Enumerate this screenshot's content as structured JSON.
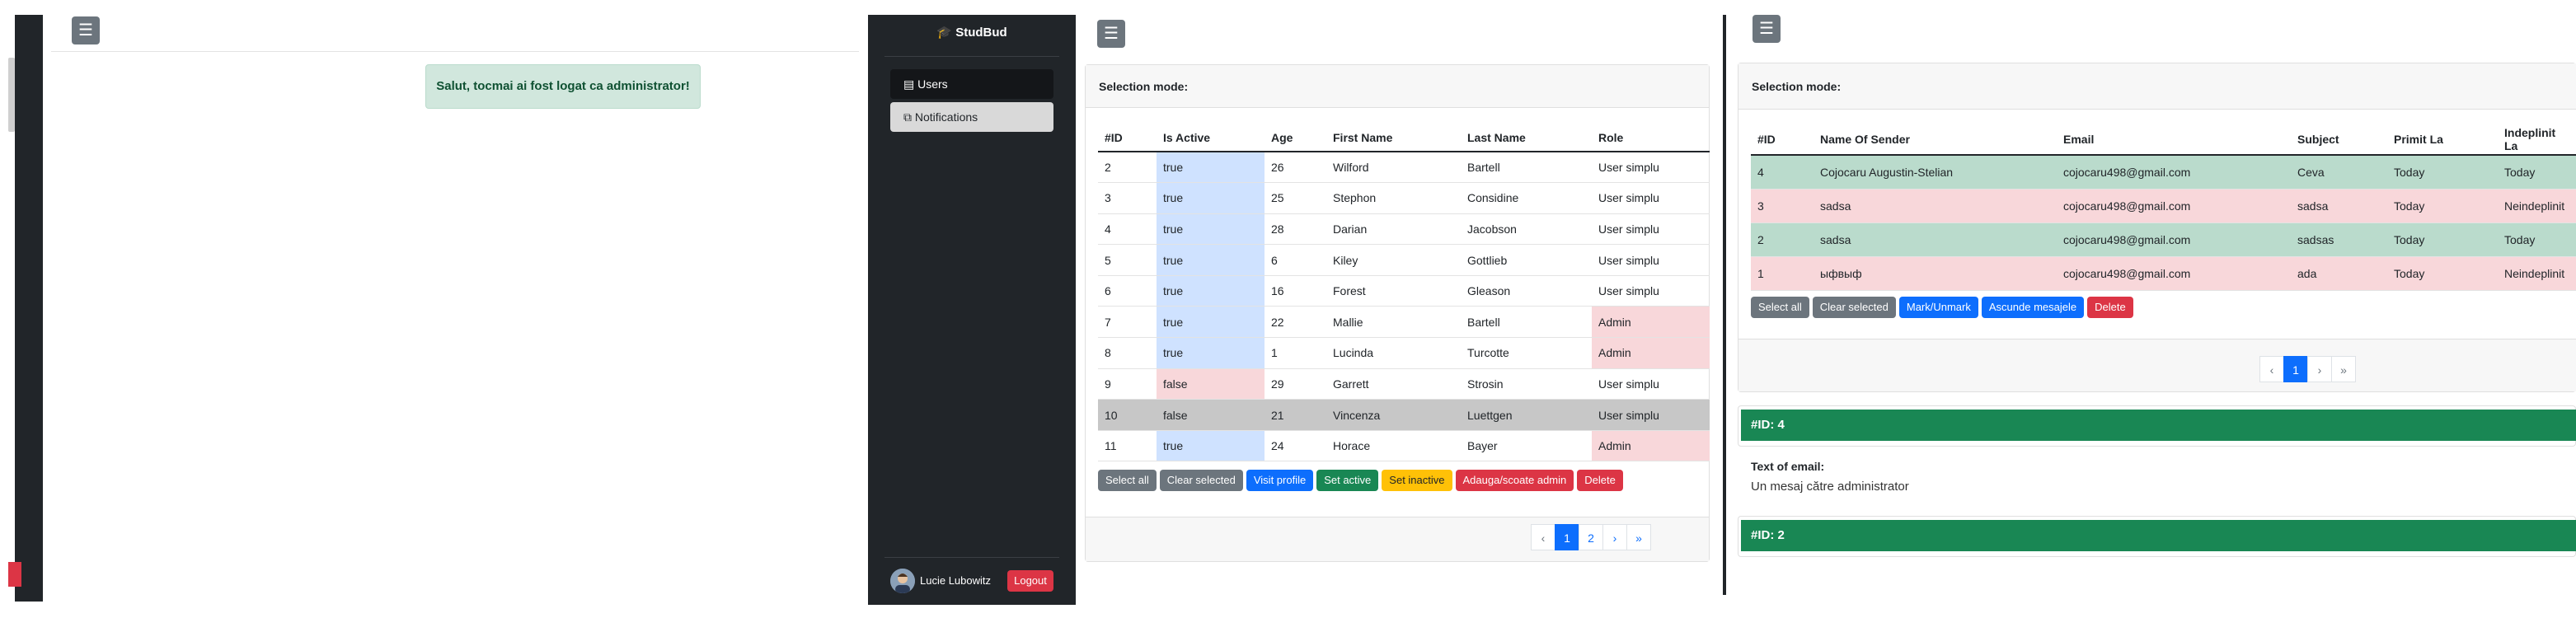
{
  "panel1": {
    "menu_icon": "menu-icon",
    "alert": "Salut, tocmai ai fost logat ca administrator!"
  },
  "sidebar": {
    "brand_icon": "graduation-cap-icon",
    "brand": "StudBud",
    "items": [
      {
        "label": "Users",
        "icon": "table-icon"
      },
      {
        "label": "Notifications",
        "icon": "external-link-icon"
      }
    ],
    "user_name": "Lucie Lubowitz",
    "logout": "Logout"
  },
  "users": {
    "selection_mode": "Selection mode:",
    "columns": [
      "#ID",
      "Is Active",
      "Age",
      "First Name",
      "Last Name",
      "Role"
    ],
    "rows": [
      {
        "id": "2",
        "active": "true",
        "age": "26",
        "first": "Wilford",
        "last": "Bartell",
        "role": "User simplu"
      },
      {
        "id": "3",
        "active": "true",
        "age": "25",
        "first": "Stephon",
        "last": "Considine",
        "role": "User simplu"
      },
      {
        "id": "4",
        "active": "true",
        "age": "28",
        "first": "Darian",
        "last": "Jacobson",
        "role": "User simplu"
      },
      {
        "id": "5",
        "active": "true",
        "age": "6",
        "first": "Kiley",
        "last": "Gottlieb",
        "role": "User simplu"
      },
      {
        "id": "6",
        "active": "true",
        "age": "16",
        "first": "Forest",
        "last": "Gleason",
        "role": "User simplu"
      },
      {
        "id": "7",
        "active": "true",
        "age": "22",
        "first": "Mallie",
        "last": "Bartell",
        "role": "Admin"
      },
      {
        "id": "8",
        "active": "true",
        "age": "1",
        "first": "Lucinda",
        "last": "Turcotte",
        "role": "Admin"
      },
      {
        "id": "9",
        "active": "false",
        "age": "29",
        "first": "Garrett",
        "last": "Strosin",
        "role": "User simplu"
      },
      {
        "id": "10",
        "active": "false",
        "age": "21",
        "first": "Vincenza",
        "last": "Luettgen",
        "role": "User simplu"
      },
      {
        "id": "11",
        "active": "true",
        "age": "24",
        "first": "Horace",
        "last": "Bayer",
        "role": "Admin"
      }
    ],
    "buttons": [
      "Select all",
      "Clear selected",
      "Visit profile",
      "Set active",
      "Set inactive",
      "Adauga/scoate admin",
      "Delete"
    ],
    "pagination": [
      "‹",
      "1",
      "2",
      "›",
      "»"
    ],
    "current_page": "1"
  },
  "messages": {
    "selection_mode": "Selection mode:",
    "columns": [
      "#ID",
      "Name Of Sender",
      "Email",
      "Subject",
      "Primit La",
      "Indeplinit La"
    ],
    "rows": [
      {
        "id": "4",
        "sender": "Cojocaru Augustin-Stelian",
        "email": "cojocaru498@gmail.com",
        "subject": "Ceva",
        "received": "Today",
        "done": "Today"
      },
      {
        "id": "3",
        "sender": "sadsa",
        "email": "cojocaru498@gmail.com",
        "subject": "sadsa",
        "received": "Today",
        "done": "Neindeplinit"
      },
      {
        "id": "2",
        "sender": "sadsa",
        "email": "cojocaru498@gmail.com",
        "subject": "sadsas",
        "received": "Today",
        "done": "Today"
      },
      {
        "id": "1",
        "sender": "ыфвыф",
        "email": "cojocaru498@gmail.com",
        "subject": "ada",
        "received": "Today",
        "done": "Neindeplinit"
      }
    ],
    "buttons": [
      "Select all",
      "Clear selected",
      "Mark/Unmark",
      "Ascunde mesajele",
      "Delete"
    ],
    "pagination": [
      "‹",
      "1",
      "›",
      "»"
    ],
    "current_page": "1",
    "detail": {
      "header_1": "#ID: 4",
      "text_label": "Text of email:",
      "text": "Un mesaj către administrator",
      "header_2": "#ID: 2"
    }
  },
  "colors": {
    "dark": "#212529",
    "active_blue": "#cfe2ff",
    "danger_pink": "#f8d7da",
    "success_green": "#badbcc",
    "primary": "#0d6efd",
    "success": "#198754",
    "danger": "#dc3545"
  }
}
